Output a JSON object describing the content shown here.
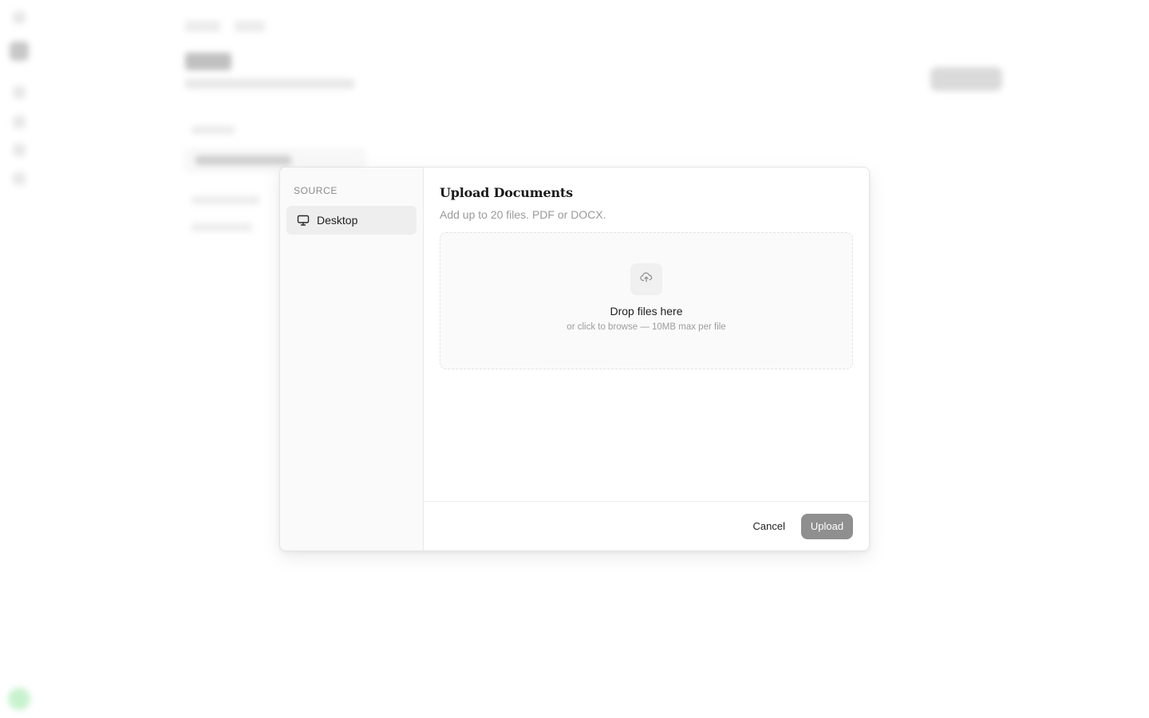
{
  "modal": {
    "sidebar": {
      "heading": "SOURCE",
      "items": [
        {
          "label": "Desktop",
          "icon": "monitor-icon",
          "selected": true
        }
      ]
    },
    "title": "Upload Documents",
    "subtitle": "Add up to 20 files. PDF or DOCX.",
    "dropzone": {
      "icon": "cloud-upload-icon",
      "title": "Drop files here",
      "hint": "or click to browse — 10MB max per file"
    },
    "footer": {
      "cancel_label": "Cancel",
      "upload_label": "Upload",
      "upload_disabled": true
    }
  },
  "colors": {
    "upload_button_disabled": "#8f8f8f",
    "sidebar_background": "#fafafa",
    "selected_item_background": "#eeeeee",
    "status_dot": "#9be8a6"
  }
}
